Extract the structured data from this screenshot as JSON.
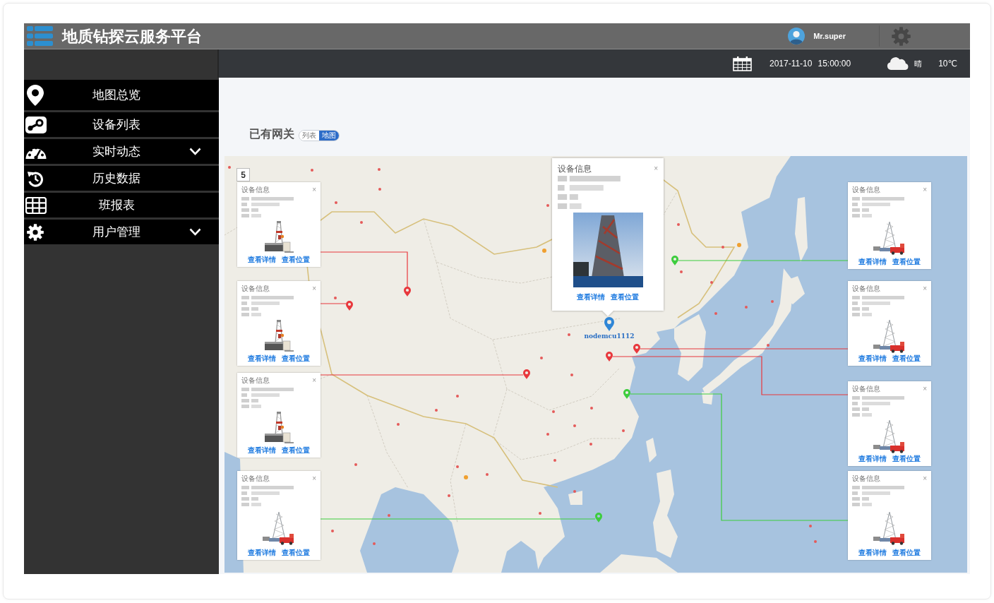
{
  "header": {
    "title": "地质钻探云服务平台",
    "user": "Mr.super"
  },
  "info_bar": {
    "date": "2017-11-10",
    "time": "15:00:00",
    "weather": "晴",
    "temperature": "10℃"
  },
  "sidebar": {
    "items": [
      {
        "label": "地图总览",
        "has_submenu": false
      },
      {
        "label": "设备列表",
        "has_submenu": false
      },
      {
        "label": "实时动态",
        "has_submenu": true
      },
      {
        "label": "历史数据",
        "has_submenu": false
      },
      {
        "label": "班报表",
        "has_submenu": false
      },
      {
        "label": "用户管理",
        "has_submenu": true
      }
    ]
  },
  "gateways": {
    "title": "已有网关",
    "view_tabs": [
      {
        "label": "列表",
        "selected": false
      },
      {
        "label": "地图",
        "selected": true
      }
    ]
  },
  "map": {
    "cluster_count": "5",
    "device_cards": [
      {
        "title": "设备信息",
        "close": "×",
        "links": [
          "查看详情",
          "查看位置"
        ],
        "color": "#e8383d"
      },
      {
        "title": "设备信息",
        "close": "×",
        "links": [
          "查看详情",
          "查看位置"
        ],
        "color": "#e8383d"
      },
      {
        "title": "设备信息",
        "close": "×",
        "links": [
          "查看详情",
          "查看位置"
        ],
        "color": "#e8383d"
      },
      {
        "title": "设备信息",
        "close": "×",
        "links": [
          "查看详情",
          "查看位置"
        ],
        "color": "#3dcd3d"
      },
      {
        "title": "设备信息",
        "close": "×",
        "links": [
          "查看详情",
          "查看位置"
        ],
        "color": "#3dcd3d"
      },
      {
        "title": "设备信息",
        "close": "×",
        "links": [
          "查看详情",
          "查看位置"
        ],
        "color": "#e8383d"
      },
      {
        "title": "设备信息",
        "close": "×",
        "links": [
          "查看详情",
          "查看位置"
        ],
        "color": "#e8383d"
      },
      {
        "title": "设备信息",
        "close": "×",
        "links": [
          "查看详情",
          "查看位置"
        ],
        "color": "#3dcd3d"
      }
    ],
    "popup": {
      "title": "设备信息",
      "close": "×",
      "links": [
        "查看详情",
        "查看位置"
      ],
      "marker_label": "nodemcu1112",
      "color": "#2f86d6"
    }
  }
}
